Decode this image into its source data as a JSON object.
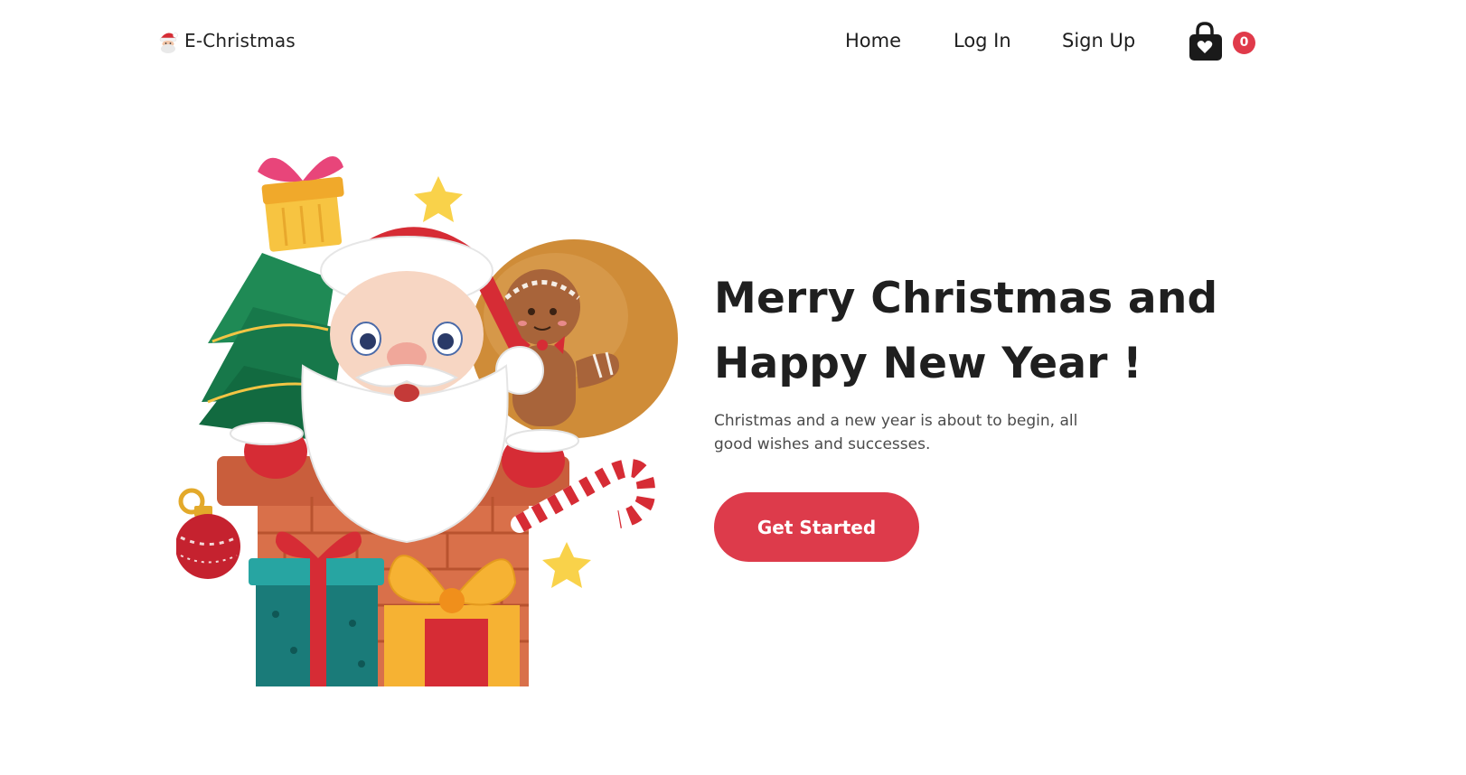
{
  "brand": {
    "name": "E-Christmas",
    "logo_icon": "santa-face-icon"
  },
  "nav": {
    "links": [
      {
        "label": "Home"
      },
      {
        "label": "Log In"
      },
      {
        "label": "Sign Up"
      }
    ],
    "cart": {
      "icon": "shopping-bag-heart-icon",
      "count": "0"
    }
  },
  "hero": {
    "title_line1": "Merry Christmas and",
    "title_line2": "Happy New Year !",
    "subtitle": "Christmas and a new year is about to begin, all good wishes and successes.",
    "cta_label": "Get Started",
    "illustration": "santa-in-chimney-with-gifts-illustration"
  },
  "colors": {
    "accent": "#dd3b4b",
    "badge": "#e03a4a",
    "text": "#1f1f1f",
    "muted": "#4b4b4b",
    "background": "#ffffff"
  }
}
